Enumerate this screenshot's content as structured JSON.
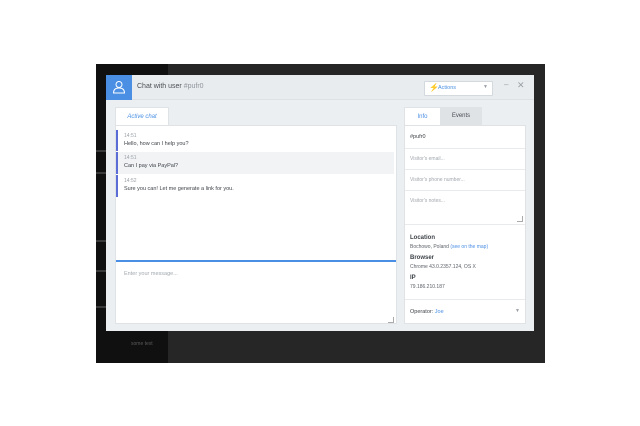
{
  "window": {
    "title": "Chat with user",
    "user_id": "#pufr0"
  },
  "toolbar": {
    "actions_label": "Actions"
  },
  "tabs": {
    "active_chat": "Active chat",
    "info": "Info",
    "events": "Events"
  },
  "messages": [
    {
      "time": "14:51",
      "text": "Hello, how can I help you?"
    },
    {
      "time": "14:51",
      "text": "Can I pay via PayPal?"
    },
    {
      "time": "14:52",
      "text": "Sure you can! Let me generate a link for you."
    }
  ],
  "composer": {
    "placeholder": "Enter your message..."
  },
  "info": {
    "visitor_id": "#pufr0",
    "email_placeholder": "Visitor's email...",
    "phone_placeholder": "Visitor's phone number...",
    "notes_placeholder": "Visitor's notes...",
    "location_label": "Location",
    "location_value": "Bochowo, Poland",
    "map_link": "(see on the map)",
    "browser_label": "Browser",
    "browser_value": "Chrome 43.0.2357.124, OS X",
    "ip_label": "IP",
    "ip_value": "79.186.210.187",
    "operator_label": "Operator:",
    "operator_name": "Joe"
  },
  "background": {
    "footer_text": "some text"
  },
  "colors": {
    "accent": "#4a8fe3",
    "message_bar": "#5a6cd6",
    "backdrop": "#262626"
  }
}
